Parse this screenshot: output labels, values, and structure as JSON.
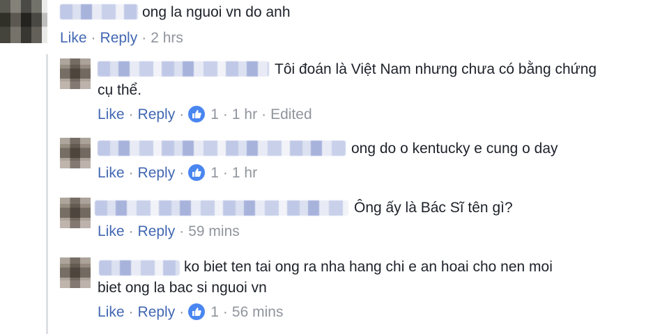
{
  "comments": [
    {
      "text": "ong la nguoi vn do anh",
      "like": "Like",
      "reply": "Reply",
      "time": "2 hrs"
    },
    {
      "text_line1": "Tôi đoán là Việt Nam nhưng chưa có bằng chứng",
      "text_line2": "cụ thể.",
      "like": "Like",
      "reply": "Reply",
      "reactions": "1",
      "time": "1 hr",
      "edited": "Edited"
    },
    {
      "text": "ong do o kentucky e cung o day",
      "like": "Like",
      "reply": "Reply",
      "reactions": "1",
      "time": "1 hr"
    },
    {
      "text": "Ông ấy là Bác Sĩ tên gì?",
      "like": "Like",
      "reply": "Reply",
      "time": "59 mins"
    },
    {
      "text_line1": "ko biet ten tai ong ra nha hang chi e an hoai cho nen moi",
      "text_line2": "biet ong la bac si nguoi vn",
      "like": "Like",
      "reply": "Reply",
      "reactions": "1",
      "time": "56 mins"
    }
  ],
  "colors": {
    "link": "#4267b2",
    "meta": "#90949c",
    "text": "#1d2129",
    "like_badge": "#4a86f0"
  },
  "icons": {
    "reaction": "thumbs-up-icon"
  }
}
